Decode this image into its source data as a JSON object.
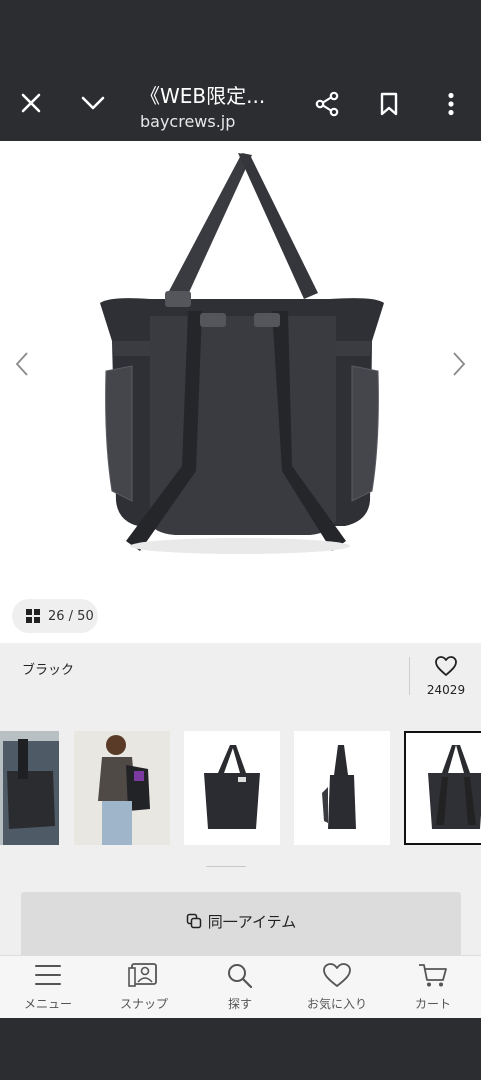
{
  "topbar": {
    "title": "《WEB限定...",
    "url": "baycrews.jp"
  },
  "gallery": {
    "counter": "26 / 50"
  },
  "product": {
    "color_name": "ブラック",
    "favorite_count": "24029"
  },
  "actions": {
    "same_item_label": "同一アイテム"
  },
  "bottom_nav": {
    "items": [
      {
        "label": "メニュー",
        "icon": "menu-icon"
      },
      {
        "label": "スナップ",
        "icon": "snap-icon"
      },
      {
        "label": "探す",
        "icon": "search-icon"
      },
      {
        "label": "お気に入り",
        "icon": "heart-icon"
      },
      {
        "label": "カート",
        "icon": "cart-icon"
      }
    ]
  }
}
